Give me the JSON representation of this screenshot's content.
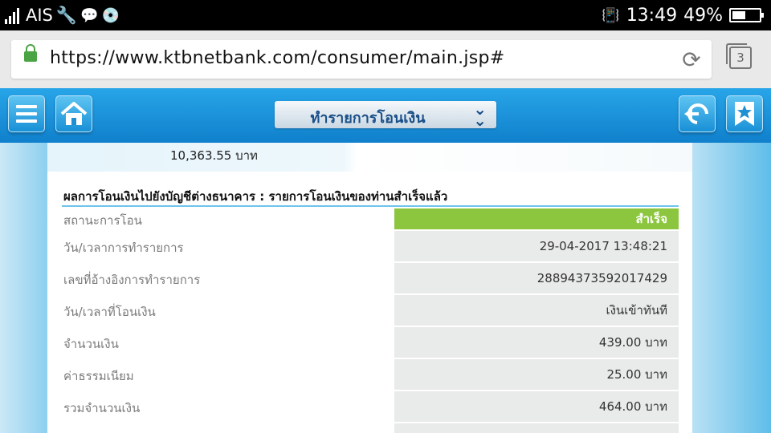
{
  "status_bar": {
    "carrier": "AIS",
    "time": "13:49",
    "battery": "49%",
    "battery_level": 0.49
  },
  "browser": {
    "url": "https://www.ktbnetbank.com/consumer/main.jsp#",
    "tab_count": "3"
  },
  "app_header": {
    "dropdown_label": "ทำรายการโอนเงิน"
  },
  "content": {
    "balance": "10,363.55 บาท",
    "heading": "ผลการโอนเงินไปยังบัญชีต่างธนาคาร : รายการโอนเงินของท่านสำเร็จแล้ว",
    "rows": [
      {
        "label": "สถานะการโอน",
        "value": "สำเร็จ"
      },
      {
        "label": "วัน/เวลาการทำรายการ",
        "value": "29-04-2017 13:48:21"
      },
      {
        "label": "เลขที่อ้างอิงการทำรายการ",
        "value": "28894373592017429"
      },
      {
        "label": "วัน/เวลาที่โอนเงิน",
        "value": "เงินเข้าทันที"
      },
      {
        "label": "จำนวนเงิน",
        "value": "439.00 บาท"
      },
      {
        "label": "ค่าธรรมเนียม",
        "value": "25.00 บาท"
      },
      {
        "label": "รวมจำนวนเงิน",
        "value": "464.00 บาท"
      }
    ]
  },
  "colors": {
    "header_blue": "#1f93d6",
    "success_green": "#8cc63f",
    "divider_blue": "#6ec3ea"
  }
}
